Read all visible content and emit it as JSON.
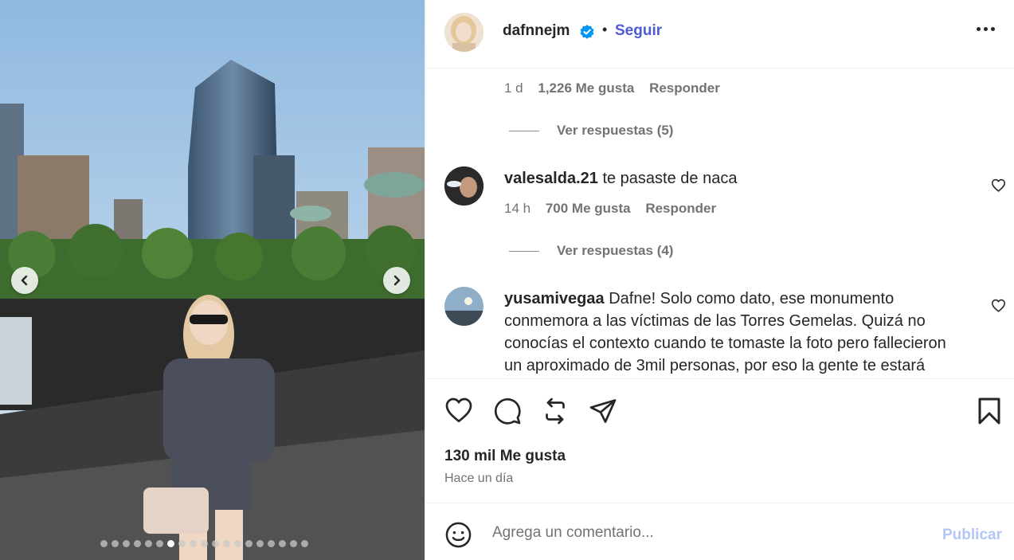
{
  "post": {
    "username": "dafnnejm",
    "separator": "•",
    "follow_label": "Seguir",
    "likes": "130 mil Me gusta",
    "posted": "Hace un día",
    "carousel_total": 19,
    "carousel_active": 6
  },
  "comments": [
    {
      "time": "1 d",
      "likes": "1,226 Me gusta",
      "reply": "Responder",
      "view_replies": "Ver respuestas (5)"
    },
    {
      "user": "valesalda.21",
      "text": "te pasaste de naca",
      "time": "14 h",
      "likes": "700 Me gusta",
      "reply": "Responder",
      "view_replies": "Ver respuestas (4)"
    },
    {
      "user": "yusamivegaa",
      "text_lines": [
        "Dafne! Solo como dato, ese monumento",
        "conmemora a las víctimas de las Torres Gemelas. Quizá no",
        "conocías el contexto cuando te tomaste la foto pero fallecieron",
        "un aproximado de 3mil personas, por eso la gente te estará"
      ]
    }
  ],
  "composer": {
    "placeholder": "Agrega un comentario...",
    "publish_label": "Publicar"
  },
  "icons": {
    "verified": "verified-badge-icon",
    "more": "more-options-icon",
    "like": "heart-icon",
    "comment": "comment-icon",
    "repost": "repost-icon",
    "share": "send-icon",
    "save": "bookmark-icon",
    "emoji": "emoji-icon",
    "prev": "chevron-left-icon",
    "next": "chevron-right-icon"
  },
  "colors": {
    "follow": "#4e5bd6",
    "verified": "#0095f6",
    "publish_disabled": "#b3c6f5"
  }
}
